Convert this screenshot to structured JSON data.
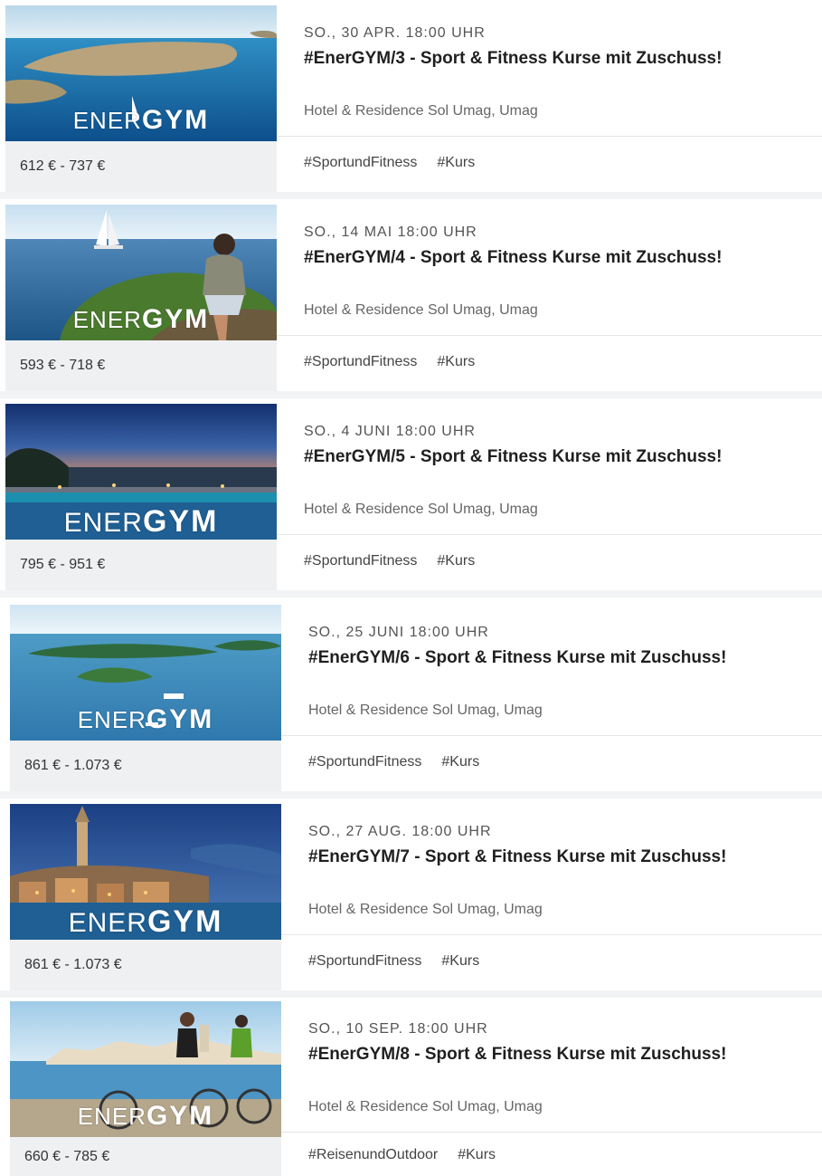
{
  "events": [
    {
      "date": "SO., 30 APR. 18:00 UHR",
      "title": "#EnerGYM/3 - Sport & Fitness Kurse mit Zuschuss!",
      "venue": "Hotel & Residence Sol Umag, Umag",
      "price": "612 € - 737 €",
      "tags": [
        "#SportundFitness",
        "#Kurs"
      ],
      "brand_light": "ENER",
      "brand_bold": "GYM"
    },
    {
      "date": "SO., 14 MAI 18:00 UHR",
      "title": "#EnerGYM/4 - Sport & Fitness Kurse mit Zuschuss!",
      "venue": "Hotel & Residence Sol Umag, Umag",
      "price": "593 € - 718 €",
      "tags": [
        "#SportundFitness",
        "#Kurs"
      ],
      "brand_light": "ENER",
      "brand_bold": "GYM"
    },
    {
      "date": "SO., 4 JUNI 18:00 UHR",
      "title": "#EnerGYM/5 - Sport & Fitness Kurse mit Zuschuss!",
      "venue": "Hotel & Residence Sol Umag, Umag",
      "price": "795 € - 951 €",
      "tags": [
        "#SportundFitness",
        "#Kurs"
      ],
      "brand_light": "ENER",
      "brand_bold": "GYM"
    },
    {
      "date": "SO., 25 JUNI 18:00 UHR",
      "title": "#EnerGYM/6 - Sport & Fitness Kurse mit Zuschuss!",
      "venue": "Hotel & Residence Sol Umag, Umag",
      "price": "861 € - 1.073 €",
      "tags": [
        "#SportundFitness",
        "#Kurs"
      ],
      "brand_light": "ENER",
      "brand_bold": "GYM"
    },
    {
      "date": "SO., 27 AUG. 18:00 UHR",
      "title": "#EnerGYM/7 - Sport & Fitness Kurse mit Zuschuss!",
      "venue": "Hotel & Residence Sol Umag, Umag",
      "price": "861 € - 1.073 €",
      "tags": [
        "#SportundFitness",
        "#Kurs"
      ],
      "brand_light": "ENER",
      "brand_bold": "GYM"
    },
    {
      "date": "SO., 10 SEP. 18:00 UHR",
      "title": "#EnerGYM/8 - Sport & Fitness Kurse mit Zuschuss!",
      "venue": "Hotel & Residence Sol Umag, Umag",
      "price": "660 € - 785 €",
      "tags": [
        "#ReisenundOutdoor",
        "#Kurs"
      ],
      "brand_light": "ENER",
      "brand_bold": "GYM"
    }
  ]
}
